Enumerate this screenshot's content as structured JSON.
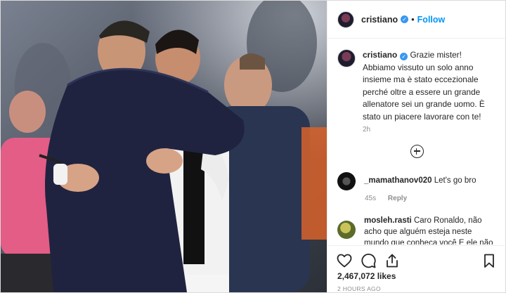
{
  "header": {
    "username": "cristiano",
    "separator": "•",
    "follow_label": "Follow"
  },
  "caption": {
    "username": "cristiano",
    "text": "Grazie mister! Abbiamo vissuto un solo anno insieme ma è stato eccezionale perché oltre a essere un grande allenatore sei un grande uomo. È stato un piacere lavorare con te!",
    "time": "2h"
  },
  "comments": [
    {
      "username": "_mamathanov020",
      "text": "Let's go bro",
      "time": "45s",
      "reply_label": "Reply"
    },
    {
      "username": "mosleh.rasti",
      "text": "Caro Ronaldo, não acho que alguém esteja neste mundo que conheça você E ele não gosta de você"
    }
  ],
  "footer": {
    "likes": "2,467,072 likes",
    "posted": "2 HOURS AGO"
  },
  "colors": {
    "accent": "#0095f6",
    "verified": "#3897f0",
    "muted": "#8e8e8e"
  },
  "icons": [
    "verified-icon",
    "load-more-icon",
    "heart-icon",
    "comment-icon",
    "share-icon",
    "bookmark-icon"
  ]
}
